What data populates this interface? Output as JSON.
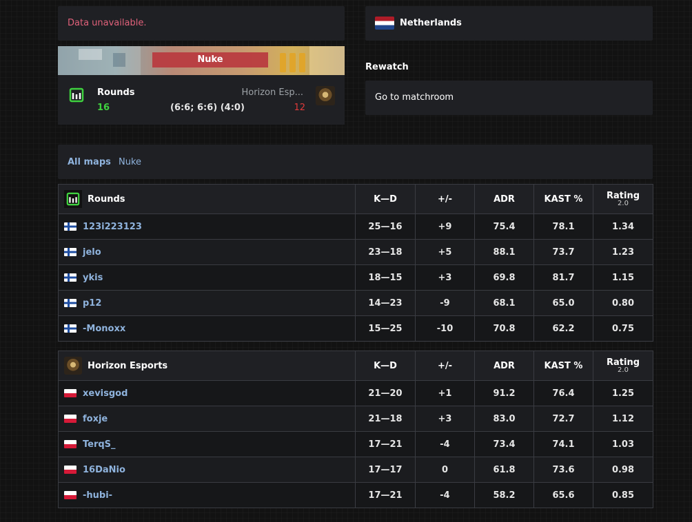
{
  "error_text": "Data unavailable.",
  "country": "Netherlands",
  "map": {
    "name": "Nuke",
    "left_team": "Rounds",
    "left_score": "16",
    "right_team": "Horizon Esp...",
    "right_score": "12",
    "half_scores": "(6:6; 6:6) (4:0)"
  },
  "rewatch": {
    "title": "Rewatch",
    "button": "Go to matchroom"
  },
  "map_tabs": {
    "all": "All maps",
    "nuke": "Nuke"
  },
  "headers": {
    "kd": "K—D",
    "pm": "+/-",
    "adr": "ADR",
    "kast": "KAST %",
    "rating": "Rating",
    "rating_sub": "2.0"
  },
  "colors": {
    "positive": "#3fd13f",
    "negative": "#e03a3a",
    "neutral": "#9ea3a8",
    "link": "#8fb3dd"
  },
  "tables": [
    {
      "team": "Rounds",
      "logo": "rounds-logo",
      "flag": "finland-flag",
      "players": [
        {
          "name": "123i223123",
          "kd": "25—16",
          "pm": "+9",
          "adr": "75.4",
          "kast": "78.1",
          "rating": "1.34"
        },
        {
          "name": "jelo",
          "kd": "23—18",
          "pm": "+5",
          "adr": "88.1",
          "kast": "73.7",
          "rating": "1.23"
        },
        {
          "name": "ykis",
          "kd": "18—15",
          "pm": "+3",
          "adr": "69.8",
          "kast": "81.7",
          "rating": "1.15"
        },
        {
          "name": "p12",
          "kd": "14—23",
          "pm": "-9",
          "adr": "68.1",
          "kast": "65.0",
          "rating": "0.80"
        },
        {
          "name": "-Monoxx",
          "kd": "15—25",
          "pm": "-10",
          "adr": "70.8",
          "kast": "62.2",
          "rating": "0.75"
        }
      ]
    },
    {
      "team": "Horizon Esports",
      "logo": "horizon-logo",
      "flag": "poland-flag",
      "players": [
        {
          "name": "xevisgod",
          "kd": "21—20",
          "pm": "+1",
          "adr": "91.2",
          "kast": "76.4",
          "rating": "1.25"
        },
        {
          "name": "foxje",
          "kd": "21—18",
          "pm": "+3",
          "adr": "83.0",
          "kast": "72.7",
          "rating": "1.12"
        },
        {
          "name": "TerqS_",
          "kd": "17—21",
          "pm": "-4",
          "adr": "73.4",
          "kast": "74.1",
          "rating": "1.03"
        },
        {
          "name": "16DaNio",
          "kd": "17—17",
          "pm": "0",
          "adr": "61.8",
          "kast": "73.6",
          "rating": "0.98"
        },
        {
          "name": "-hubi-",
          "kd": "17—21",
          "pm": "-4",
          "adr": "58.2",
          "kast": "65.6",
          "rating": "0.85"
        }
      ]
    }
  ]
}
